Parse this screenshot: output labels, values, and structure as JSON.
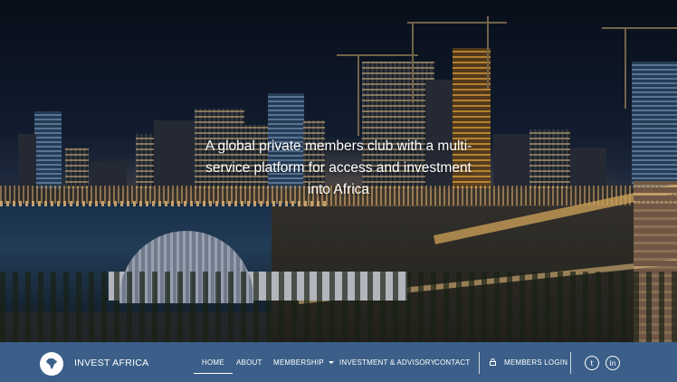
{
  "hero": {
    "tagline": "A global private members club with a multi-service platform for access and investment into Africa"
  },
  "brand": {
    "name": "INVEST AFRICA",
    "logo_icon": "africa-globe-icon"
  },
  "nav": {
    "items": [
      {
        "label": "HOME",
        "active": true
      },
      {
        "label": "ABOUT",
        "active": false
      },
      {
        "label": "MEMBERSHIP",
        "active": false,
        "has_dropdown": true
      },
      {
        "label": "INVESTMENT & ADVISORY",
        "active": false
      },
      {
        "label": "CONTACT",
        "active": false
      }
    ],
    "members_login": "MEMBERS LOGIN",
    "members_login_icon": "lock-icon"
  },
  "social": {
    "twitter_glyph": "t",
    "linkedin_glyph": "in",
    "twitter_icon": "twitter-icon",
    "linkedin_icon": "linkedin-icon"
  },
  "colors": {
    "navbar": "#3b5f88",
    "text": "#ffffff"
  }
}
